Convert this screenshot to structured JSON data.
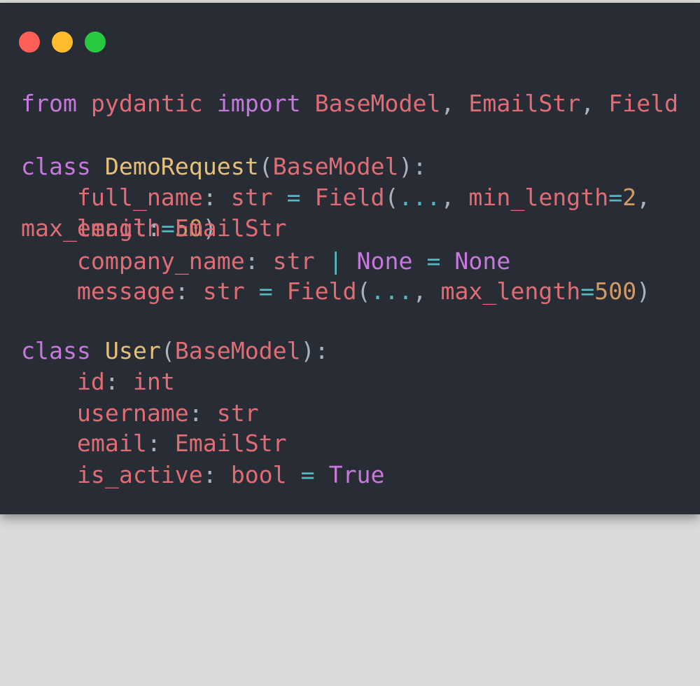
{
  "window": {
    "dots": [
      {
        "name": "close",
        "color": "#ff5f56"
      },
      {
        "name": "minimize",
        "color": "#ffbd2e"
      },
      {
        "name": "maximize",
        "color": "#27c93f"
      }
    ]
  },
  "colors": {
    "background": "#282c34",
    "keyword": "#c678dd",
    "name": "#e06c75",
    "punctuation": "#abb2bf",
    "class_name": "#e5c07b",
    "operator": "#56b6c2",
    "number": "#d19a66"
  },
  "code": {
    "l1": {
      "t1": "from",
      "t2": " pydantic ",
      "t3": "import",
      "t4": " BaseModel",
      "t5": ",",
      "t6": " EmailStr",
      "t7": ",",
      "t8": " Field"
    },
    "l2": {
      "t1": "class",
      "t2": " DemoRequest",
      "t3": "(",
      "t4": "BaseModel",
      "t5": "):"
    },
    "l3": {
      "t1": "    full_name",
      "t2": ":",
      "t3": " str ",
      "t4": "=",
      "t5": " Field",
      "t6": "(",
      "t7": "...",
      "t8": ",",
      "t9": " min_length",
      "t10": "=",
      "t11": "2",
      "t12": ","
    },
    "l4a": {
      "t1": "max_length",
      "t2": "=",
      "t3": "50",
      "t4": ")"
    },
    "l4b": {
      "t1": "    email",
      "t2": ":",
      "t3": " EmailStr"
    },
    "l5": {
      "t1": "    company_name",
      "t2": ":",
      "t3": " str ",
      "t4": "|",
      "t5": " None ",
      "t6": "=",
      "t7": " None"
    },
    "l6": {
      "t1": "    message",
      "t2": ":",
      "t3": " str ",
      "t4": "=",
      "t5": " Field",
      "t6": "(",
      "t7": "...",
      "t8": ",",
      "t9": " max_length",
      "t10": "=",
      "t11": "500",
      "t12": ")"
    },
    "l7": {
      "t1": "class",
      "t2": " User",
      "t3": "(",
      "t4": "BaseModel",
      "t5": "):"
    },
    "l8": {
      "t1": "    id",
      "t2": ":",
      "t3": " int"
    },
    "l9": {
      "t1": "    username",
      "t2": ":",
      "t3": " str"
    },
    "l10": {
      "t1": "    email",
      "t2": ":",
      "t3": " EmailStr"
    },
    "l11": {
      "t1": "    is_active",
      "t2": ":",
      "t3": " bool ",
      "t4": "=",
      "t5": " True"
    }
  }
}
